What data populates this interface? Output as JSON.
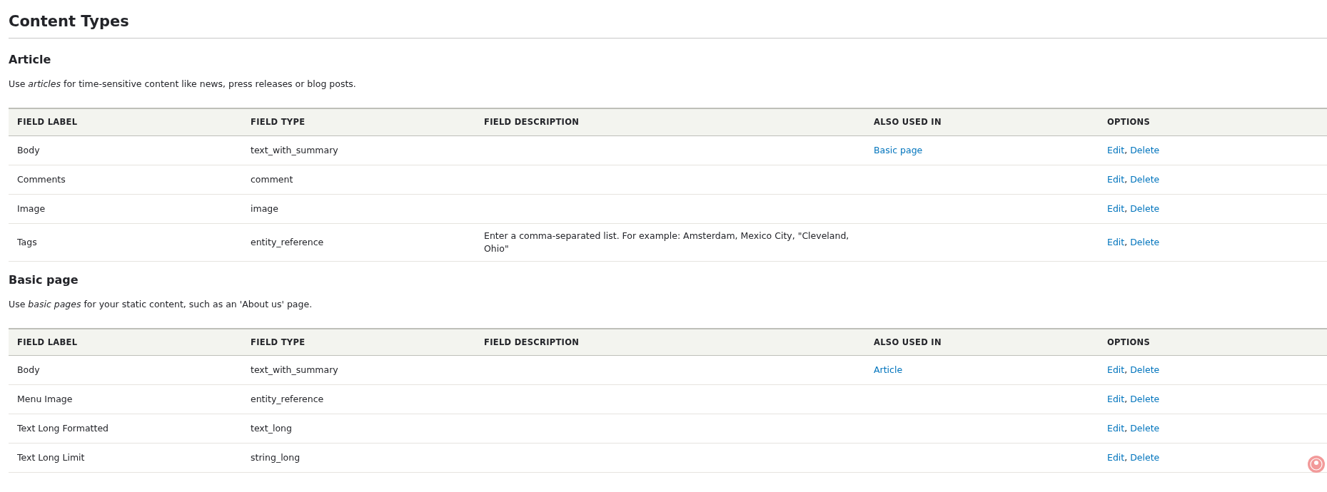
{
  "page_title": "Content Types",
  "sections": [
    {
      "title": "Article",
      "description": "Use *articles* for time-sensitive content like news, press releases or blog posts.",
      "columns": [
        "FIELD LABEL",
        "FIELD TYPE",
        "FIELD DESCRIPTION",
        "ALSO USED IN",
        "OPTIONS"
      ],
      "rows": [
        {
          "label": "Body",
          "type": "text_with_summary",
          "description": "",
          "used_in": [
            "Basic page"
          ],
          "options": [
            {
              "kind": "link",
              "text": "Edit"
            },
            {
              "kind": "separator",
              "text": ","
            },
            {
              "kind": "link",
              "text": "Delete"
            }
          ]
        },
        {
          "label": "Comments",
          "type": "comment",
          "description": "",
          "used_in": [],
          "options": [
            {
              "kind": "link",
              "text": "Edit"
            },
            {
              "kind": "separator",
              "text": ","
            },
            {
              "kind": "link",
              "text": "Delete"
            }
          ]
        },
        {
          "label": "Image",
          "type": "image",
          "description": "",
          "used_in": [],
          "options": [
            {
              "kind": "link",
              "text": "Edit"
            },
            {
              "kind": "separator",
              "text": ","
            },
            {
              "kind": "link",
              "text": "Delete"
            }
          ]
        },
        {
          "label": "Tags",
          "type": "entity_reference",
          "description": "Enter a comma-separated list. For example: Amsterdam, Mexico City, \"Cleveland, Ohio\"",
          "used_in": [],
          "options": [
            {
              "kind": "link",
              "text": "Edit"
            },
            {
              "kind": "separator",
              "text": ","
            },
            {
              "kind": "link",
              "text": "Delete"
            }
          ]
        }
      ]
    },
    {
      "title": "Basic page",
      "description": "Use *basic pages* for your static content, such as an 'About us' page.",
      "columns": [
        "FIELD LABEL",
        "FIELD TYPE",
        "FIELD DESCRIPTION",
        "ALSO USED IN",
        "OPTIONS"
      ],
      "rows": [
        {
          "label": "Body",
          "type": "text_with_summary",
          "description": "",
          "used_in": [
            "Article"
          ],
          "options": [
            {
              "kind": "link",
              "text": "Edit"
            },
            {
              "kind": "separator",
              "text": ","
            },
            {
              "kind": "link",
              "text": "Delete"
            }
          ]
        },
        {
          "label": "Menu Image",
          "type": "entity_reference",
          "description": "",
          "used_in": [],
          "options": [
            {
              "kind": "link",
              "text": "Edit"
            },
            {
              "kind": "separator",
              "text": ","
            },
            {
              "kind": "link",
              "text": "Delete"
            }
          ]
        },
        {
          "label": "Text Long Formatted",
          "type": "text_long",
          "description": "",
          "used_in": [],
          "options": [
            {
              "kind": "link",
              "text": "Edit"
            },
            {
              "kind": "separator",
              "text": ","
            },
            {
              "kind": "link",
              "text": "Delete"
            }
          ]
        },
        {
          "label": "Text Long Limit",
          "type": "string_long",
          "description": "",
          "used_in": [],
          "options": [
            {
              "kind": "link",
              "text": "Edit"
            },
            {
              "kind": "separator",
              "text": ","
            },
            {
              "kind": "link",
              "text": "Delete"
            }
          ]
        }
      ]
    }
  ]
}
